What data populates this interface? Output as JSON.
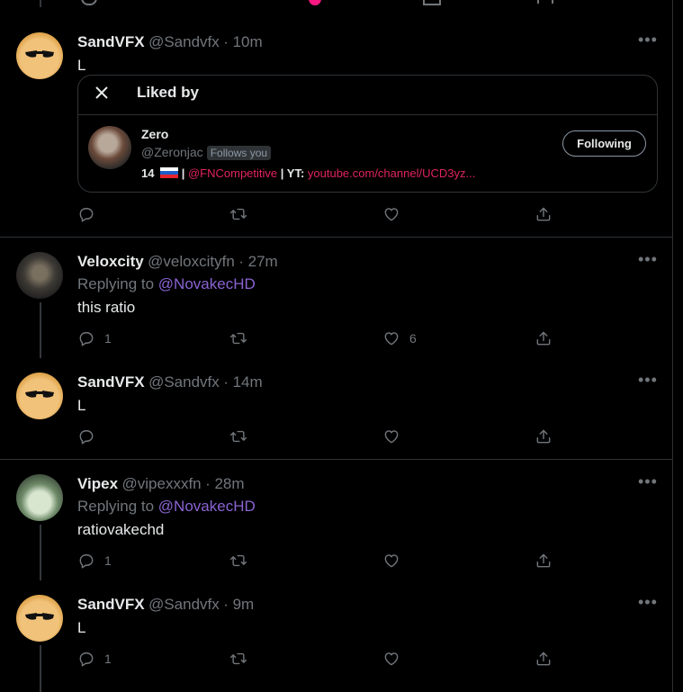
{
  "top_bar": {
    "heart_color": "#f91880"
  },
  "liked_tweet": {
    "author": "SandVFX",
    "handle": "@Sandvfx",
    "time": "· 10m",
    "text": "L",
    "liked_by": {
      "title": "Liked by",
      "user": {
        "name": "Zero",
        "handle": "@Zeronjac",
        "follows_you": "Follows you",
        "bio_number": "14",
        "bio_sep1": " | ",
        "bio_mention": "@FNCompetitive",
        "bio_sep2": " | YT: ",
        "bio_link": "youtube.com/channel/UCD3yz...",
        "button": "Following"
      }
    }
  },
  "tweets": [
    {
      "author": "Veloxcity",
      "handle": "@veloxcityfn",
      "time": "· 27m",
      "replying_prefix": "Replying to",
      "replying_to": "@NovakecHD",
      "text": "this ratio",
      "replies": "1",
      "likes": "6"
    },
    {
      "author": "SandVFX",
      "handle": "@Sandvfx",
      "time": "· 14m",
      "text": "L"
    },
    {
      "author": "Vipex",
      "handle": "@vipexxxfn",
      "time": "· 28m",
      "replying_prefix": "Replying to",
      "replying_to": "@NovakecHD",
      "text": "ratiovakechd",
      "replies": "1"
    },
    {
      "author": "SandVFX",
      "handle": "@Sandvfx",
      "time": "· 9m",
      "text": "L",
      "replies": "1"
    }
  ],
  "icons": {
    "reply": "reply-icon",
    "retweet": "retweet-icon",
    "like": "heart-icon",
    "share": "share-icon",
    "more": "more-icon",
    "close": "close-icon"
  },
  "colors": {
    "link": "#8a63d2",
    "mention": "#e0245e",
    "background": "#000000"
  }
}
